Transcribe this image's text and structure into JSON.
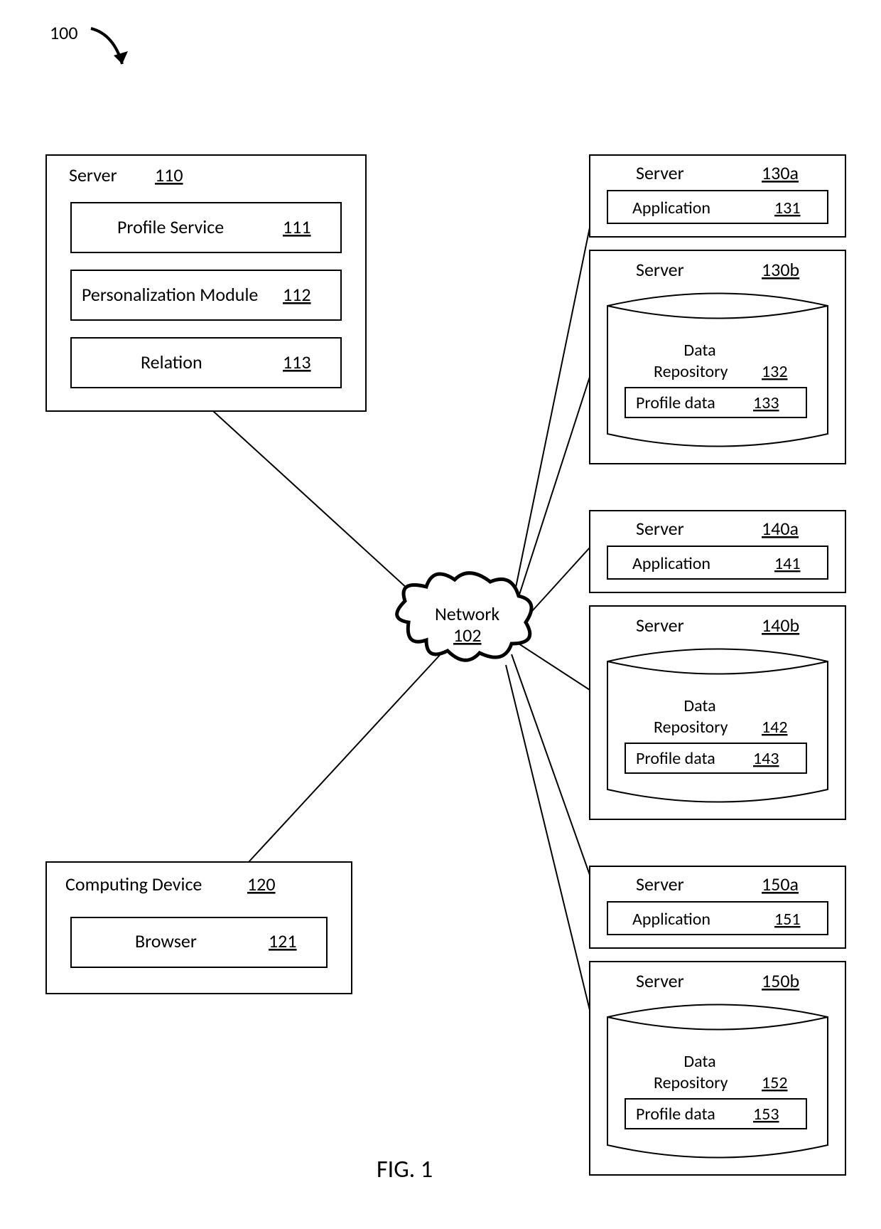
{
  "figure": {
    "ref": "100",
    "caption": "FIG. 1"
  },
  "network": {
    "label": "Network",
    "ref": "102"
  },
  "server110": {
    "title": "Server",
    "ref": "110",
    "profile_service": {
      "label": "Profile Service",
      "ref": "111"
    },
    "personalization": {
      "label": "Personalization Module",
      "ref": "112"
    },
    "relation": {
      "label": "Relation",
      "ref": "113"
    }
  },
  "computing_device": {
    "title": "Computing Device",
    "ref": "120",
    "browser": {
      "label": "Browser",
      "ref": "121"
    }
  },
  "group1": {
    "app_server": {
      "title": "Server",
      "ref": "130a",
      "app_label": "Application",
      "app_ref": "131"
    },
    "repo_server": {
      "title": "Server",
      "ref": "130b",
      "repo_label": "Data\nRepository",
      "repo_ref": "132",
      "profile_label": "Profile data",
      "profile_ref": "133"
    }
  },
  "group2": {
    "app_server": {
      "title": "Server",
      "ref": "140a",
      "app_label": "Application",
      "app_ref": "141"
    },
    "repo_server": {
      "title": "Server",
      "ref": "140b",
      "repo_label": "Data\nRepository",
      "repo_ref": "142",
      "profile_label": "Profile data",
      "profile_ref": "143"
    }
  },
  "group3": {
    "app_server": {
      "title": "Server",
      "ref": "150a",
      "app_label": "Application",
      "app_ref": "151"
    },
    "repo_server": {
      "title": "Server",
      "ref": "150b",
      "repo_label": "Data\nRepository",
      "repo_ref": "152",
      "profile_label": "Profile data",
      "profile_ref": "153"
    }
  }
}
